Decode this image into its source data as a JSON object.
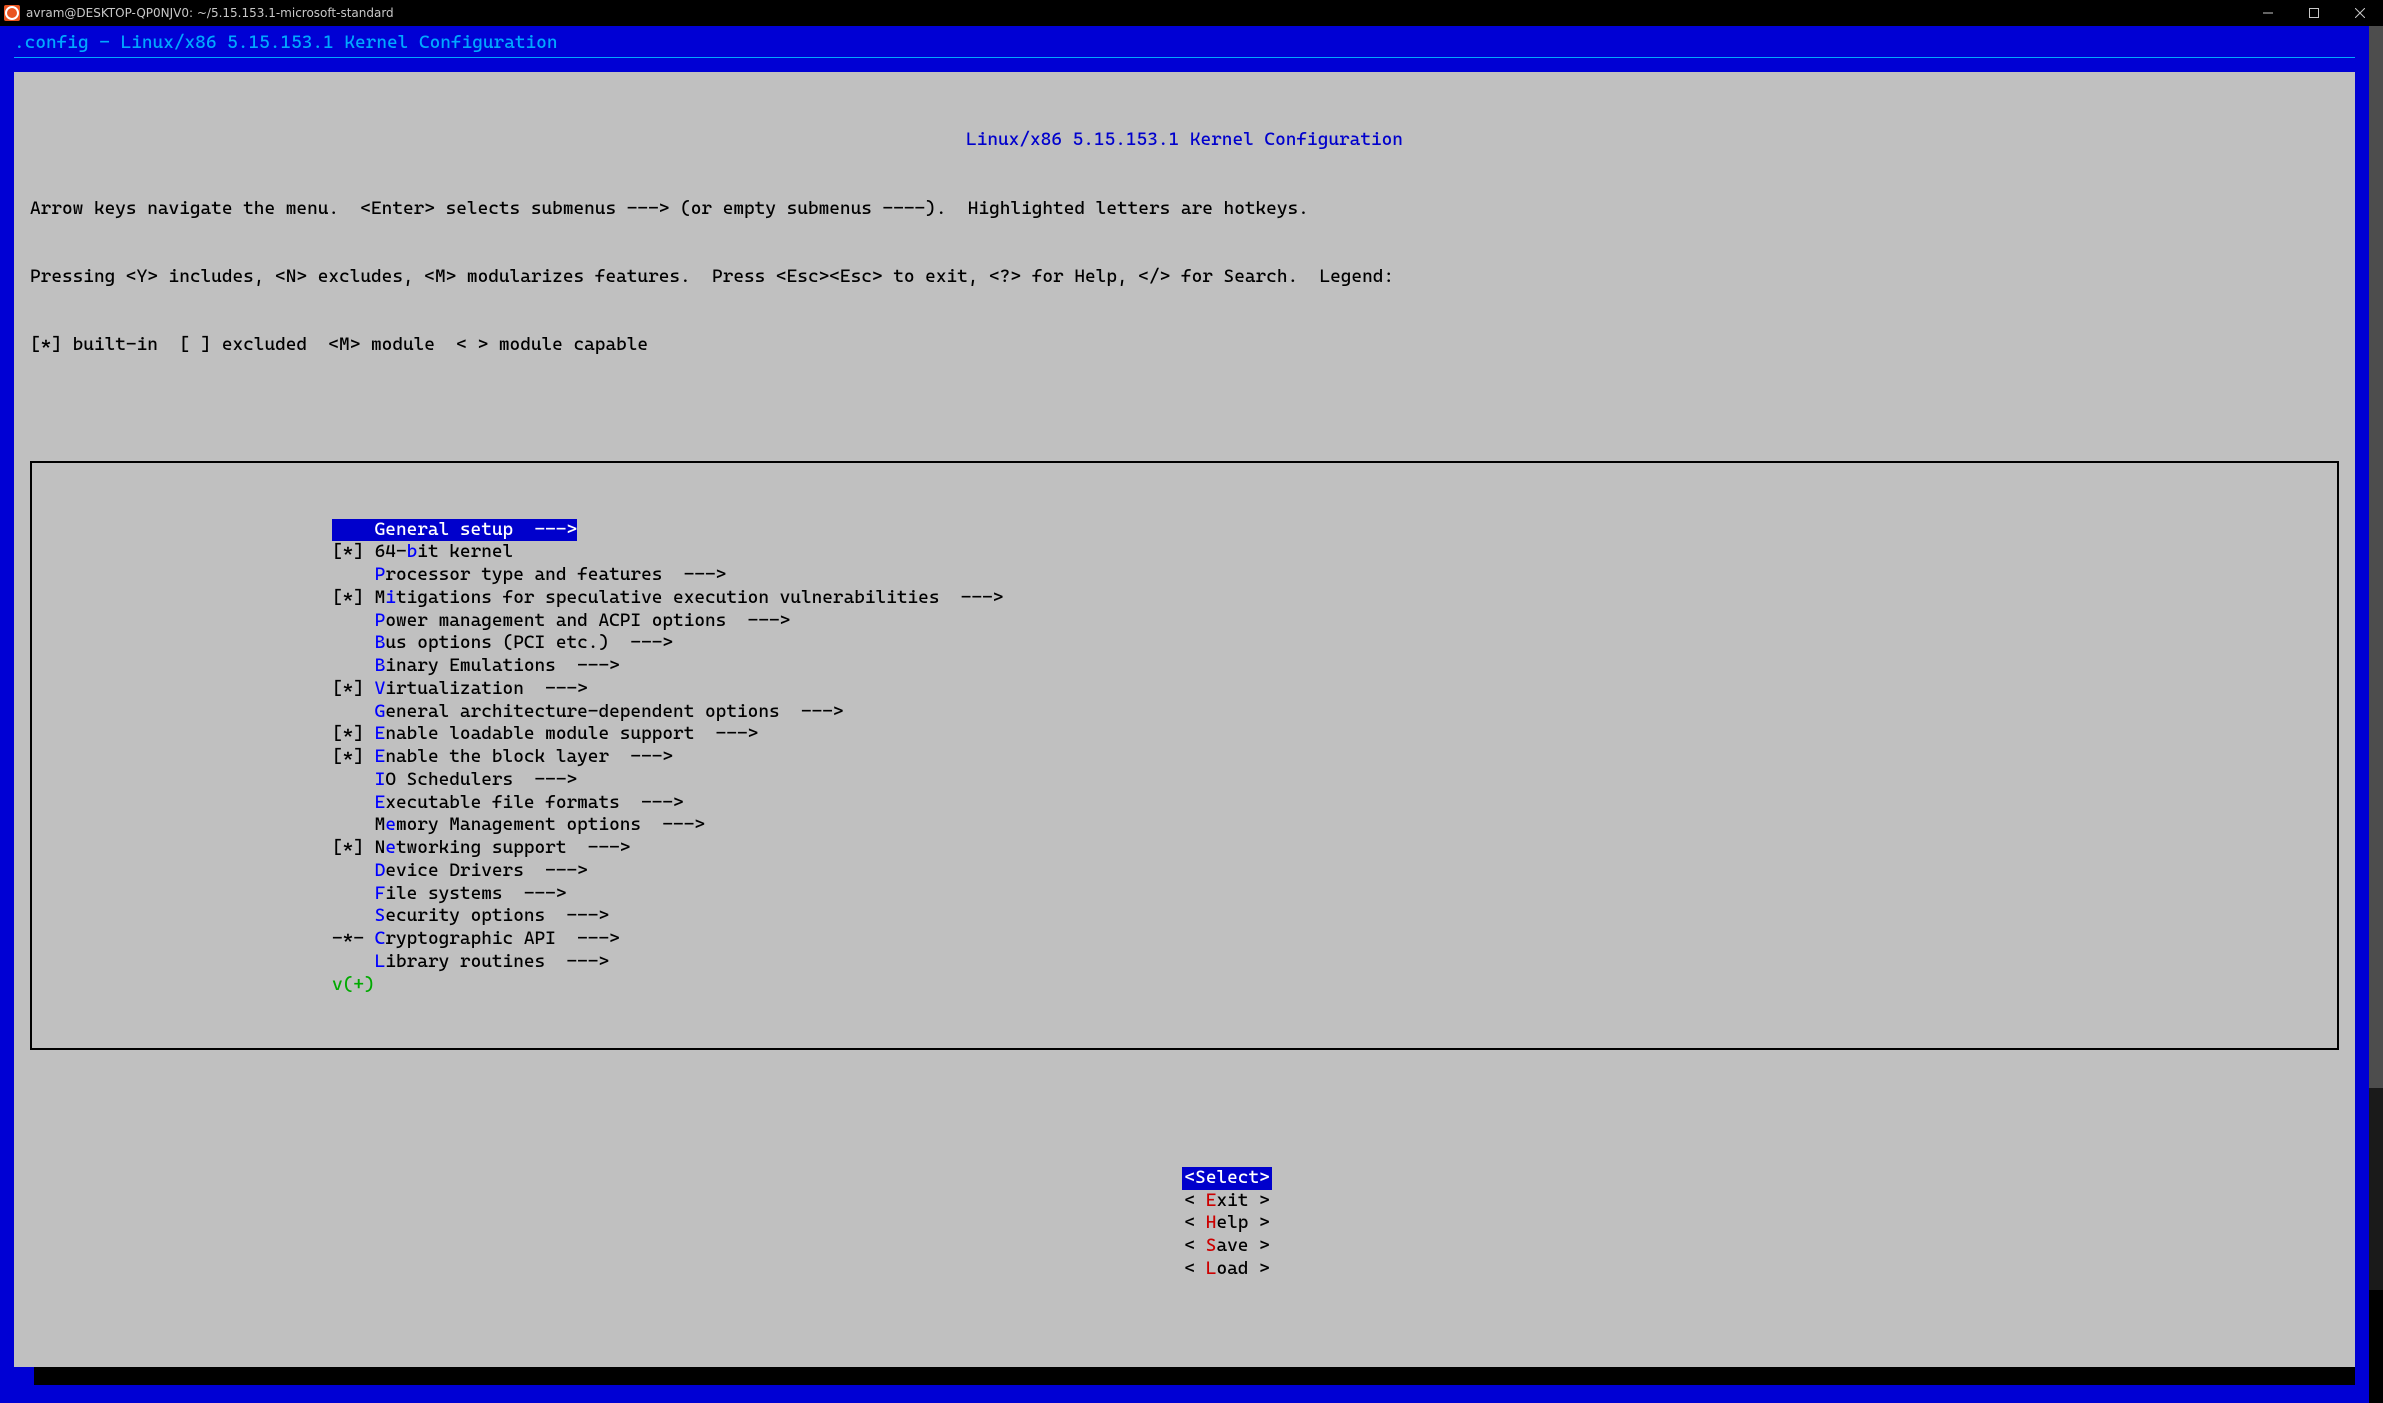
{
  "window": {
    "title": "avram@DESKTOP-QP0NJV0: ~/5.15.153.1-microsoft-standard"
  },
  "header_line": ".config - Linux/x86 5.15.153.1 Kernel Configuration",
  "panel": {
    "title": "Linux/x86 5.15.153.1 Kernel Configuration",
    "help_line1": "Arrow keys navigate the menu.  <Enter> selects submenus ---> (or empty submenus ----).  Highlighted letters are hotkeys.",
    "help_line2": "Pressing <Y> includes, <N> excludes, <M> modularizes features.  Press <Esc><Esc> to exit, <?> for Help, </> for Search.  Legend:",
    "help_line3": "[*] built-in  [ ] excluded  <M> module  < > module capable"
  },
  "menu": {
    "more_indicator": "v(+)",
    "items": [
      {
        "prefix": "   ",
        "rest": " General setup  --->",
        "selected": true
      },
      {
        "prefix": "[*]",
        "pre": " 64-",
        "hot": "b",
        "rest": "it kernel"
      },
      {
        "prefix": "   ",
        "pre": " ",
        "hot": "P",
        "rest": "rocessor type and features  --->"
      },
      {
        "prefix": "[*]",
        "pre": " M",
        "hot": "i",
        "rest": "tigations for speculative execution vulnerabilities  --->"
      },
      {
        "prefix": "   ",
        "pre": " ",
        "hot": "P",
        "rest": "ower management and ACPI options  --->"
      },
      {
        "prefix": "   ",
        "pre": " ",
        "hot": "B",
        "rest": "us options (PCI etc.)  --->"
      },
      {
        "prefix": "   ",
        "pre": " ",
        "hot": "B",
        "rest": "inary Emulations  --->"
      },
      {
        "prefix": "[*]",
        "pre": " ",
        "hot": "V",
        "rest": "irtualization  --->"
      },
      {
        "prefix": "   ",
        "pre": " ",
        "hot": "G",
        "rest": "eneral architecture-dependent options  --->"
      },
      {
        "prefix": "[*]",
        "pre": " ",
        "hot": "E",
        "rest": "nable loadable module support  --->"
      },
      {
        "prefix": "[*]",
        "pre": " ",
        "hot": "E",
        "rest": "nable the block layer  --->"
      },
      {
        "prefix": "   ",
        "pre": " ",
        "hot": "I",
        "rest": "O Schedulers  --->"
      },
      {
        "prefix": "   ",
        "pre": " ",
        "hot": "E",
        "rest": "xecutable file formats  --->"
      },
      {
        "prefix": "   ",
        "pre": " M",
        "hot": "e",
        "rest": "mory Management options  --->"
      },
      {
        "prefix": "[*]",
        "pre": " N",
        "hot": "e",
        "rest": "tworking support  --->"
      },
      {
        "prefix": "   ",
        "pre": " ",
        "hot": "D",
        "rest": "evice Drivers  --->"
      },
      {
        "prefix": "   ",
        "pre": " ",
        "hot": "F",
        "rest": "ile systems  --->"
      },
      {
        "prefix": "   ",
        "pre": " ",
        "hot": "S",
        "rest": "ecurity options  --->"
      },
      {
        "prefix": "-*-",
        "pre": " ",
        "hot": "C",
        "rest": "ryptographic API  --->"
      },
      {
        "prefix": "   ",
        "pre": " ",
        "hot": "L",
        "rest": "ibrary routines  --->"
      }
    ]
  },
  "buttons": {
    "select": {
      "open": "<",
      "label": "Select",
      "close": ">"
    },
    "exit": {
      "open": "< ",
      "hk": "E",
      "rest": "xit",
      "close": " >"
    },
    "help": {
      "open": "< ",
      "hk": "H",
      "rest": "elp",
      "close": " >"
    },
    "save": {
      "open": "< ",
      "hk": "S",
      "rest": "ave",
      "close": " >"
    },
    "load": {
      "open": "< ",
      "hk": "L",
      "rest": "oad",
      "close": " >"
    }
  }
}
